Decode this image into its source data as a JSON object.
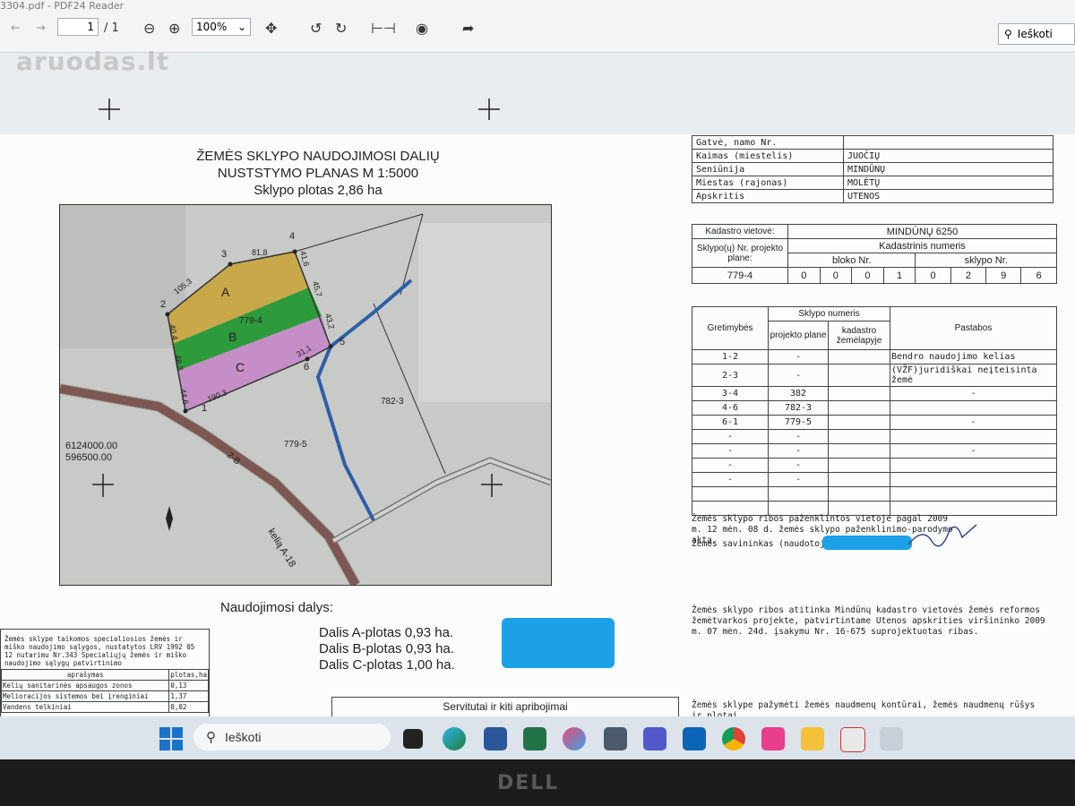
{
  "viewer": {
    "title_tab": "3304.pdf - PDF24 Reader",
    "page_current": "1",
    "page_total": "/ 1",
    "zoom": "100%",
    "search_placeholder": "Ieškoti"
  },
  "watermark": "aruodas.lt",
  "document": {
    "title_line1": "ŽEMĖS SKLYPO NAUDOJIMOSI DALIŲ",
    "title_line2": "NUSTSTYMO PLANAS  M 1:5000",
    "title_line3": "Sklypo plotas    2,86 ha",
    "info_rows": [
      {
        "label": "Gatvė, namo Nr.",
        "value": ""
      },
      {
        "label": "Kaimas (miestelis)",
        "value": "JUOČIŲ"
      },
      {
        "label": "Seniūnija",
        "value": "MINDŪNŲ"
      },
      {
        "label": "Miestas (rajonas)",
        "value": "MOLĖTŲ"
      },
      {
        "label": "Apskritis",
        "value": "UTENOS"
      }
    ],
    "cadastre": {
      "label": "Kadastro vietovė:",
      "value": "MINDŪNŲ  6250",
      "header": "Kadastrinis numeris",
      "plot_label": "Sklypo(ų) Nr. projekto plane:",
      "block_label": "bloko Nr.",
      "plot_nr_label": "sklypo Nr.",
      "project_nr": "779-4",
      "digits": [
        "0",
        "0",
        "0",
        "1",
        "0",
        "2",
        "9",
        "6"
      ]
    },
    "adjacency": {
      "col_neighbors": "Gretimybės",
      "col_plot_nr": "Sklypo numeris",
      "col_project": "projekto plane",
      "col_cadastre": "kadastro žemėlapyje",
      "col_notes": "Pastabos",
      "rows": [
        {
          "g": "1-2",
          "p": "-",
          "k": "",
          "n": "Bendro naudojimo kelias"
        },
        {
          "g": "2-3",
          "p": "-",
          "k": "",
          "n": "(VŽF)juridiškai neįteisinta žemė"
        },
        {
          "g": "3-4",
          "p": "382",
          "k": "",
          "n": "-"
        },
        {
          "g": "4-6",
          "p": "782-3",
          "k": "",
          "n": ""
        },
        {
          "g": "6-1",
          "p": "779-5",
          "k": "",
          "n": "-"
        },
        {
          "g": "-",
          "p": "-",
          "k": "",
          "n": ""
        },
        {
          "g": "-",
          "p": "-",
          "k": "",
          "n": "-"
        },
        {
          "g": "-",
          "p": "-",
          "k": "",
          "n": ""
        },
        {
          "g": "-",
          "p": "-",
          "k": "",
          "n": ""
        },
        {
          "g": "",
          "p": "",
          "k": "",
          "n": ""
        },
        {
          "g": "",
          "p": "",
          "k": "",
          "n": ""
        }
      ]
    },
    "marking_note": "Žemės sklypo ribos paženklintos vietoje pagal 2009 m. 12 mėn. 08 d. žemės sklypo paženklinimo-parodymo aktą.",
    "owner_label": "Žemės savininkas (naudotojas):",
    "compliance_note": "Žemės sklypo ribos atitinka Mindūnų kadastro vietovės žemės reformos žemėtvarkos projekte, patvirtintame Utenos apskrities viršininko 2009 m. 07 mėn. 24d. įsakymu Nr. 16-675 suprojektuotas ribas.",
    "bottom_note": "Žemės sklype pažymėti žemės naudmenų kontūrai, žemės naudmenų rūšys ir plotai",
    "parts_title": "Naudojimosi dalys:",
    "parts": [
      "Dalis A-plotas 0,93 ha.",
      "Dalis B-plotas 0,93 ha.",
      "Dalis C-plotas 1,00 ha."
    ],
    "servitudes_title": "Servitutai ir kiti apribojimai",
    "special_conditions_text": "Žemės sklype taikomos specialiosios žemės ir miško naudojimo sąlygos, nustatytos LRV 1992 05 12 nutarimu Nr.343 Specialiųjų žemės ir miško naudojimo sąlygų patvirtinimo",
    "special_header": {
      "desc": "aprašymas",
      "area": "plotas,ha"
    },
    "special_rows": [
      {
        "desc": "Kelių sanitarinės apsaugos zonos",
        "area": "0,13"
      },
      {
        "desc": "Melioracijos sistemos bei įrenginiai",
        "area": "1,37"
      },
      {
        "desc": "Vandens telkiniai",
        "area": "0,02"
      }
    ],
    "map": {
      "coord_y": "6124000.00",
      "coord_x": "596500.00",
      "parcel_id": "779-4",
      "parcel_south": "779-5",
      "parcel_east": "782-3",
      "area_a": "A",
      "area_b": "B",
      "area_c": "C",
      "road_label": "kelią A-18",
      "road_num": "2-B",
      "points": [
        "1",
        "2",
        "3",
        "4",
        "5",
        "6"
      ],
      "dims": [
        "105,3",
        "81,8",
        "41,6",
        "45,7",
        "43,2",
        "31,1",
        "190,3",
        "44,6",
        "48,3",
        "40,4"
      ],
      "colors": {
        "a": "#c9a84a",
        "b": "#2d9a3b",
        "c": "#c58ec6",
        "road": "#8b5a52",
        "canal": "#2c5fa8"
      }
    }
  },
  "taskbar": {
    "search_placeholder": "Ieškoti",
    "apps": [
      "windows-start",
      "task-view",
      "edge",
      "word",
      "excel",
      "paint",
      "mail",
      "teams",
      "outlook",
      "chrome",
      "pos",
      "file-explorer",
      "snip",
      "pdf24"
    ]
  },
  "bezel_brand": "DELL"
}
